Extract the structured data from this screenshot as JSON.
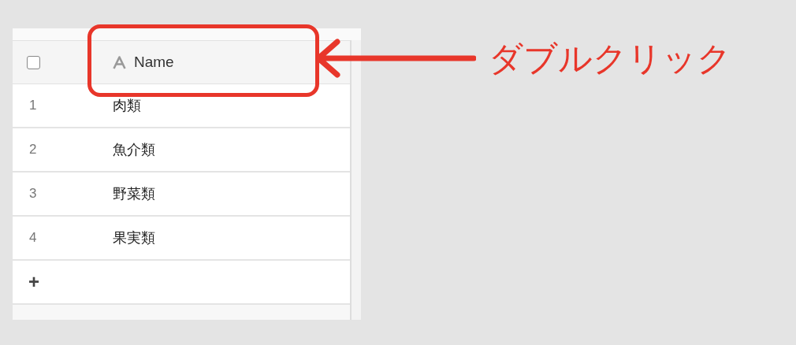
{
  "table": {
    "header": {
      "checked": false,
      "column": {
        "label": "Name"
      }
    },
    "rows": [
      {
        "number": "1",
        "name": "肉類"
      },
      {
        "number": "2",
        "name": "魚介類"
      },
      {
        "number": "3",
        "name": "野菜類"
      },
      {
        "number": "4",
        "name": "果実類"
      }
    ],
    "add_row": "+"
  },
  "annotation": {
    "text": "ダブルクリック"
  }
}
